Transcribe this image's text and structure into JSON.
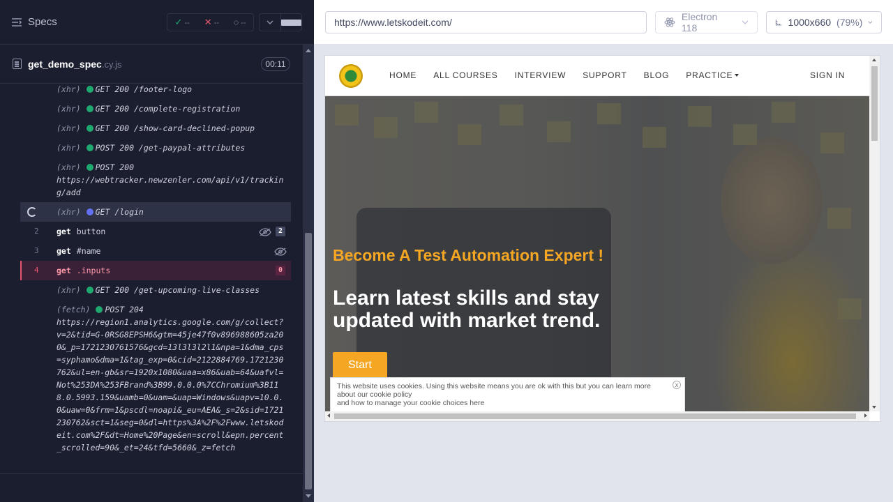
{
  "reporter": {
    "specs_label": "Specs",
    "stats": {
      "passed": "--",
      "failed": "--",
      "pending": "--"
    },
    "spec": {
      "name": "get_demo_spec",
      "ext": ".cy.js",
      "timer": "00:11"
    },
    "log": [
      {
        "type": "xhr",
        "kind": "(xhr)",
        "text": "GET 200 /footer-logo"
      },
      {
        "type": "xhr",
        "kind": "(xhr)",
        "text": "GET 200 /complete-registration"
      },
      {
        "type": "xhr",
        "kind": "(xhr)",
        "text": "GET 200 /show-card-declined-popup"
      },
      {
        "type": "xhr",
        "kind": "(xhr)",
        "text": "POST 200 /get-paypal-attributes"
      },
      {
        "type": "xhr",
        "kind": "(xhr)",
        "text": "POST 200",
        "url": "https://webtracker.newzenler.com/api/v1/tracking/add"
      },
      {
        "type": "pending",
        "kind": "(xhr)",
        "text": "GET /login"
      },
      {
        "type": "cmd",
        "num": "2",
        "cmd": "get",
        "sel": "button",
        "badge": "2",
        "hidden": true
      },
      {
        "type": "cmd",
        "num": "3",
        "cmd": "get",
        "sel": "#name",
        "hidden": true
      },
      {
        "type": "failed",
        "num": "4",
        "cmd": "get",
        "sel": ".inputs",
        "badge": "0"
      },
      {
        "type": "xhr",
        "kind": "(xhr)",
        "text": "GET 200 /get-upcoming-live-classes"
      },
      {
        "type": "xhr",
        "kind": "(fetch)",
        "text": "POST 204",
        "url": "https://region1.analytics.google.com/g/collect?v=2&tid=G-0RSG8EPSH6&gtm=45je47f0v896988605za200&_p=1721230761576&gcd=13l3l3l2l1&npa=1&dma_cps=syphamo&dma=1&tag_exp=0&cid=2122884769.1721230762&ul=en-gb&sr=1920x1080&uaa=x86&uab=64&uafvl=Not%253DA%253FBrand%3B99.0.0.0%7CChromium%3B118.0.5993.159&uamb=0&uam=&uap=Windows&uapv=10.0.0&uaw=0&frm=1&pscdl=noapi&_eu=AEA&_s=2&sid=1721230762&sct=1&seg=0&dl=https%3A%2F%2Fwww.letskodeit.com%2F&dt=Home%20Page&en=scroll&epn.percent_scrolled=90&_et=24&tfd=5660&_z=fetch"
      }
    ]
  },
  "aut": {
    "url": "https://www.letskodeit.com/",
    "browser": "Electron 118",
    "viewport": "1000x660",
    "zoom": "(79%)"
  },
  "site": {
    "nav": [
      "HOME",
      "ALL COURSES",
      "INTERVIEW",
      "SUPPORT",
      "BLOG"
    ],
    "practice": "PRACTICE",
    "signin": "SIGN IN",
    "hero_sub": "Become A Test Automation Expert !",
    "hero_title": "Learn latest skills and stay updated with market trend.",
    "start_btn": "Start",
    "cookie_line1": "This website uses cookies. Using this website means you are ok with this but you can learn more about our",
    "cookie_link": "cookie policy",
    "cookie_line2": "and how to manage your cookie choices here",
    "cookie_close": "x"
  },
  "colors": {
    "accent": "#f5a623",
    "pass": "#1fa971",
    "fail": "#e45770",
    "pending": "#6470f3"
  }
}
